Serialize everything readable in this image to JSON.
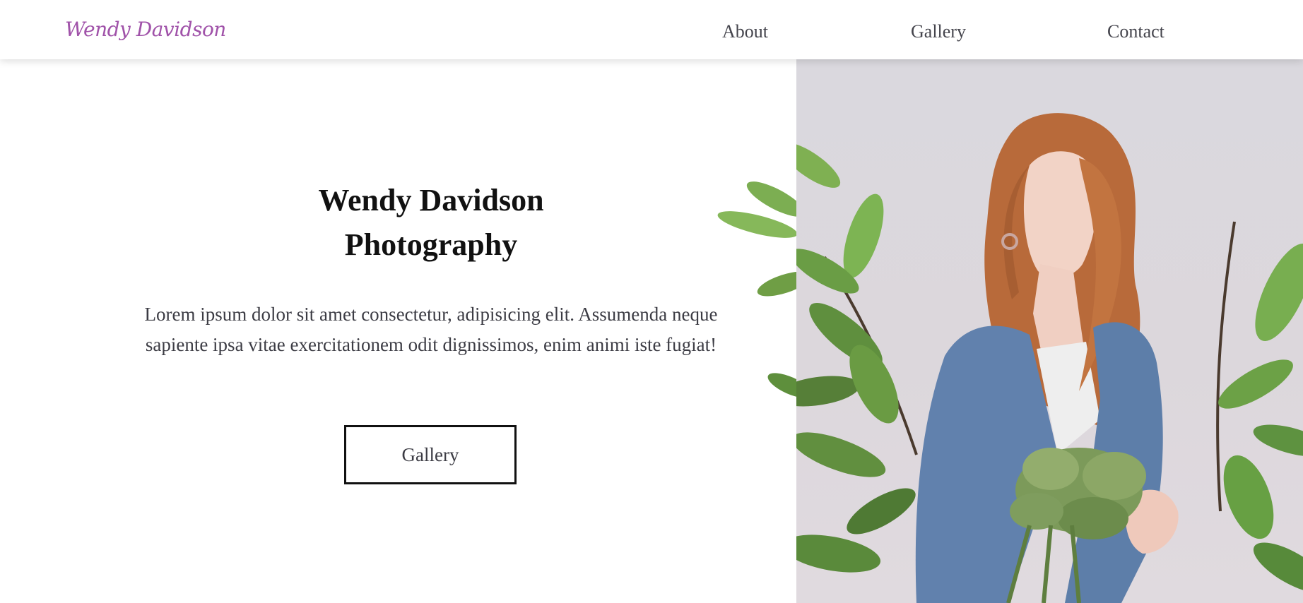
{
  "header": {
    "brand": "Wendy Davidson",
    "nav": [
      {
        "label": "About"
      },
      {
        "label": "Gallery"
      },
      {
        "label": "Contact"
      }
    ]
  },
  "hero": {
    "title_line1": "Wendy Davidson",
    "title_line2": "Photography",
    "description": "Lorem ipsum dolor sit amet consectetur, adipisicing elit. Assumenda neque sapiente ipsa vitae exercitationem odit dignissimos, enim animi iste fugiat!",
    "button_label": "Gallery"
  },
  "colors": {
    "brand": "#a052a9",
    "nav_text": "#44444c",
    "title": "#111111",
    "body_text": "#3c3c44",
    "photo_background": "#dad8de"
  }
}
